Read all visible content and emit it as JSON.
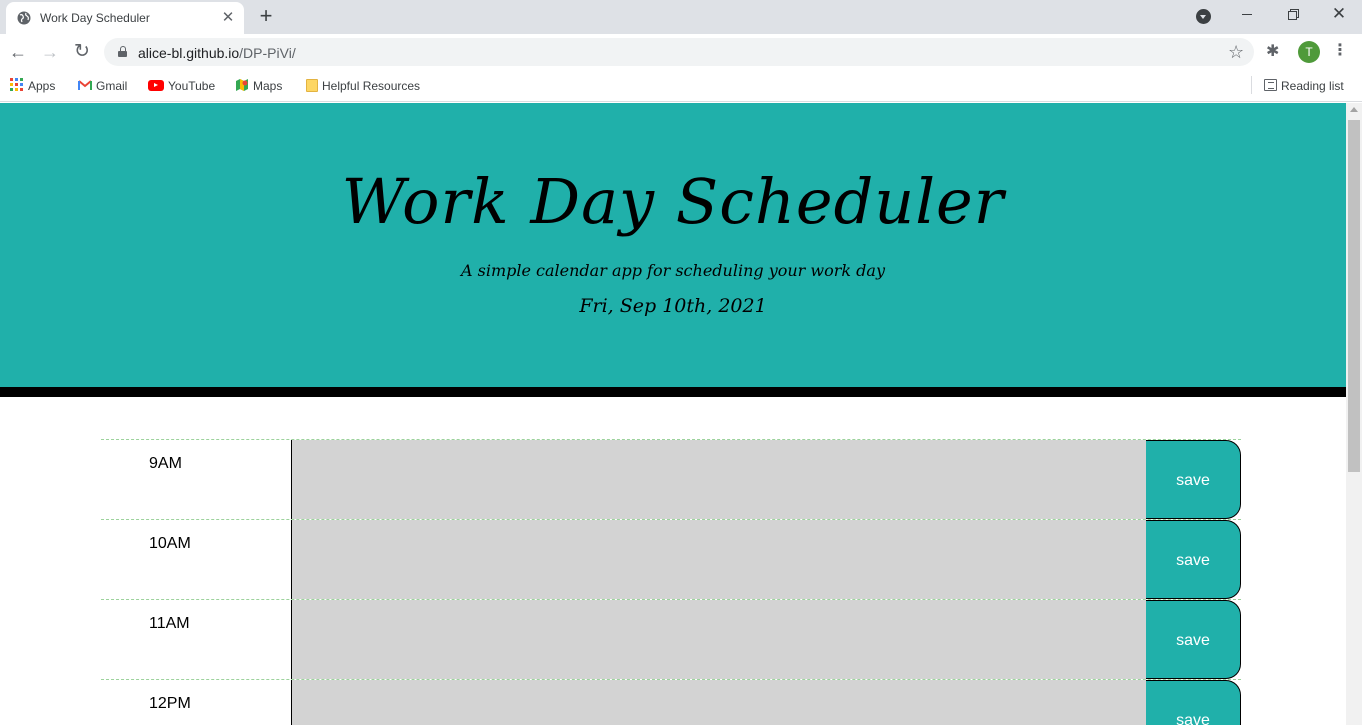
{
  "browser": {
    "tab_title": "Work Day Scheduler",
    "url_host": "alice-bl.github.io",
    "url_path": "/DP-PiVi/",
    "profile_initial": "T",
    "bookmarks": [
      {
        "label": "Apps",
        "icon": "apps-grid-icon"
      },
      {
        "label": "Gmail",
        "icon": "gmail-icon"
      },
      {
        "label": "YouTube",
        "icon": "youtube-icon"
      },
      {
        "label": "Maps",
        "icon": "maps-icon"
      },
      {
        "label": "Helpful Resources",
        "icon": "folder-icon"
      }
    ],
    "reading_list": "Reading list"
  },
  "header": {
    "title": "Work Day Scheduler",
    "subtitle": "A simple calendar app for scheduling your work day",
    "current_day": "Fri, Sep 10th, 2021"
  },
  "hours": [
    {
      "label": "9AM",
      "description": "",
      "save_label": "save"
    },
    {
      "label": "10AM",
      "description": "",
      "save_label": "save"
    },
    {
      "label": "11AM",
      "description": "",
      "save_label": "save"
    },
    {
      "label": "12PM",
      "description": "",
      "save_label": "save"
    }
  ],
  "colors": {
    "accent": "#20b0aa",
    "past_block": "#d3d3d3",
    "header_border": "#000000"
  }
}
